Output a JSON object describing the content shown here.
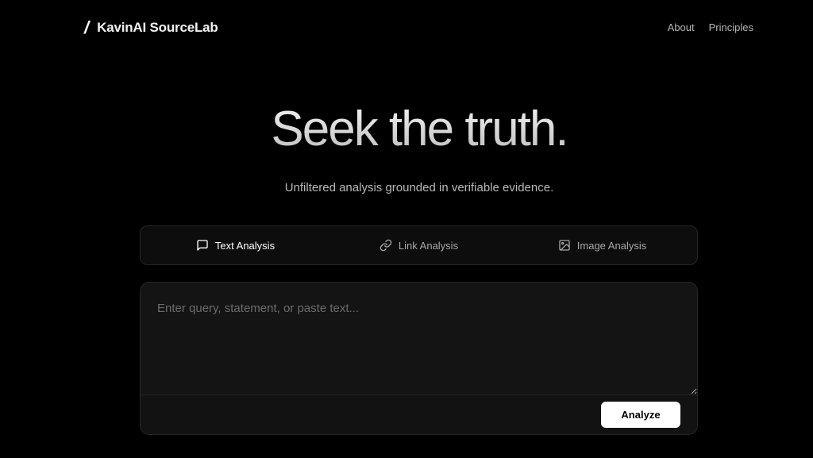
{
  "header": {
    "brand_slash": "/",
    "brand_name": "KavinAI SourceLab",
    "nav": [
      {
        "label": "About"
      },
      {
        "label": "Principles"
      }
    ]
  },
  "hero": {
    "title": "Seek the truth.",
    "subtitle": "Unfiltered analysis grounded in verifiable evidence."
  },
  "tabs": [
    {
      "label": "Text Analysis",
      "icon": "message-square-icon",
      "active": true
    },
    {
      "label": "Link Analysis",
      "icon": "link-icon",
      "active": false
    },
    {
      "label": "Image Analysis",
      "icon": "image-icon",
      "active": false
    }
  ],
  "composer": {
    "placeholder": "Enter query, statement, or paste text...",
    "value": "",
    "submit_label": "Analyze"
  },
  "colors": {
    "background": "#000000",
    "surface": "#141414",
    "border": "#262626",
    "button": "#ffffff"
  }
}
